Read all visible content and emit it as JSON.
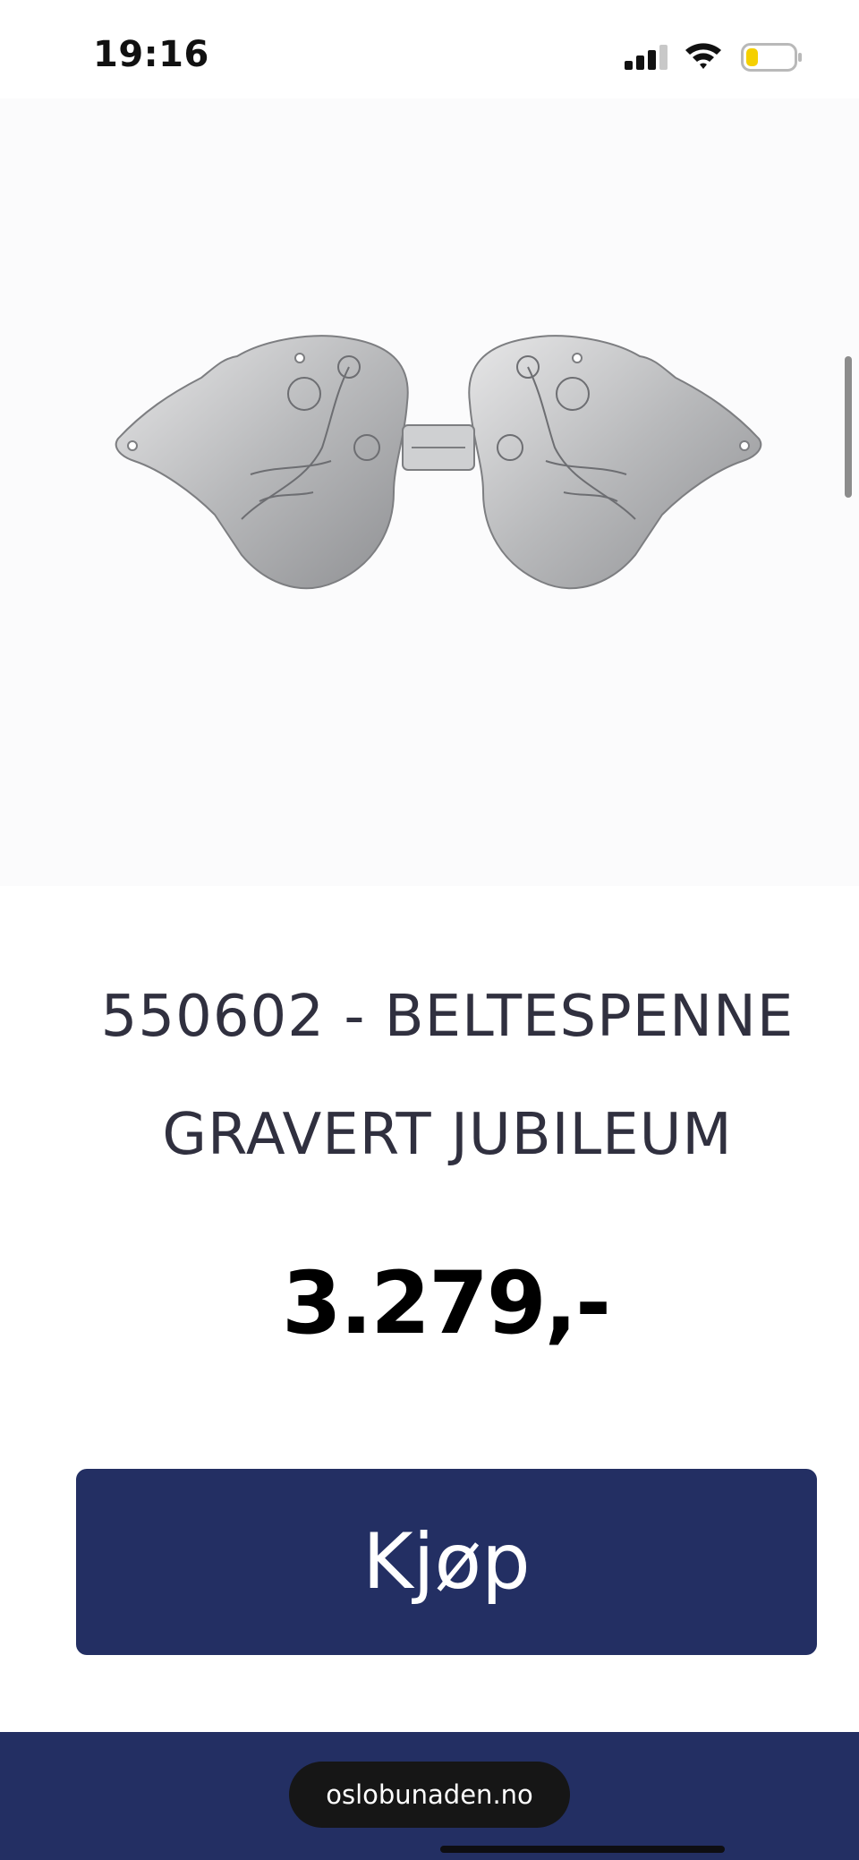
{
  "status_bar": {
    "time": "19:16",
    "signal_icon": "cellular-signal-icon",
    "wifi_icon": "wifi-icon",
    "battery_icon": "battery-low-icon",
    "battery_level": 0.25,
    "battery_color": "#f5d000"
  },
  "product": {
    "title_line1": "550602 - BELTESPENNE",
    "title_line2": "GRAVERT JUBILEUM",
    "price": "3.279,-",
    "image": "engraved-silver-belt-buckle"
  },
  "buy_button": {
    "label": "Kjøp"
  },
  "browser": {
    "url": "oslobunaden.no"
  },
  "colors": {
    "brand_navy": "#232f63",
    "title_text": "#30303f",
    "price_text": "#000000"
  }
}
